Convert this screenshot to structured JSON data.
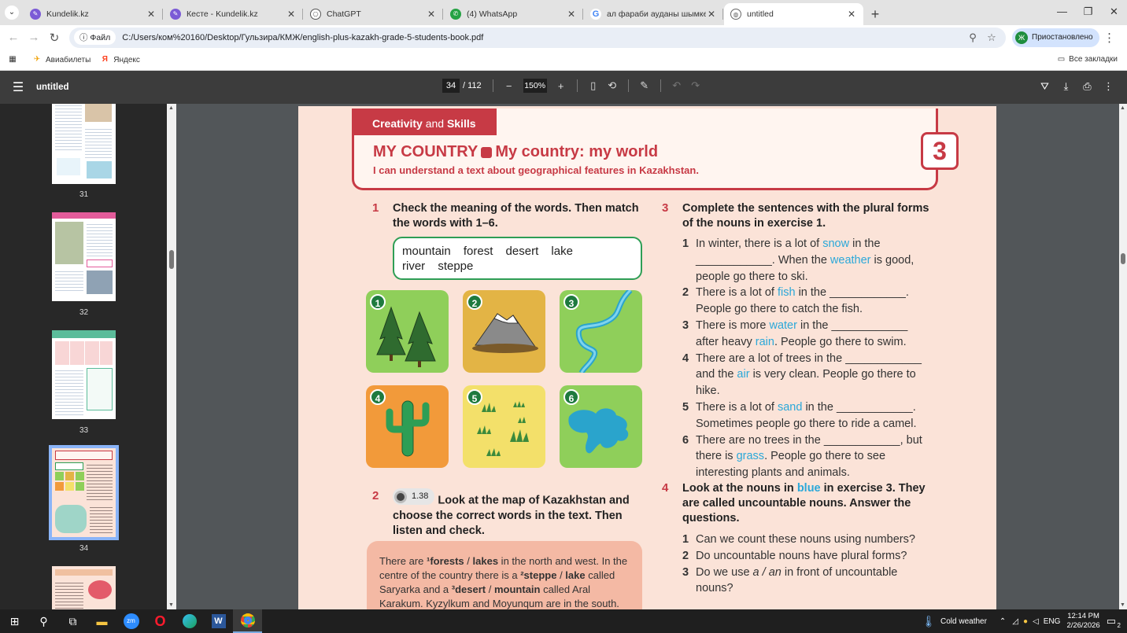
{
  "browser": {
    "tabs": [
      {
        "title": "Kundelik.kz",
        "icon": "kundelik-icon",
        "active": false
      },
      {
        "title": "Кесте - Kundelik.kz",
        "icon": "kundelik-icon",
        "active": false
      },
      {
        "title": "ChatGPT",
        "icon": "chatgpt-icon",
        "active": false
      },
      {
        "title": "(4) WhatsApp",
        "icon": "whatsapp-icon",
        "active": false
      },
      {
        "title": "ал фараби ауданы шымкент -",
        "icon": "google-icon",
        "active": false
      },
      {
        "title": "untitled",
        "icon": "globe-icon",
        "active": true
      }
    ],
    "file_chip": "Файл",
    "url": "C:/Users/ком%20160/Desktop/Гульзира/КМЖ/english-plus-kazakh-grade-5-students-book.pdf",
    "profile_initial": "Ж",
    "profile_label": "Приостановлено",
    "bookmarks": [
      {
        "label": "Авиабилеты",
        "icon": "plane-icon"
      },
      {
        "label": "Яндекс",
        "icon": "yandex-icon"
      }
    ],
    "all_bookmarks": "Все закладки"
  },
  "pdf": {
    "title": "untitled",
    "page_current": "34",
    "page_total": "/ 112",
    "zoom": "150%",
    "thumbnails": [
      {
        "num": "31"
      },
      {
        "num": "32"
      },
      {
        "num": "33"
      },
      {
        "num": "34"
      }
    ]
  },
  "page": {
    "section_tab_1": "Creativity",
    "section_tab_and": "and",
    "section_tab_2": "Skills",
    "unit_title": "MY COUNTRY",
    "unit_subtitle": "My country: my world",
    "can_do": "I can understand a text about geographical features in Kazakhstan.",
    "unit_number": "3",
    "ex1": {
      "num": "1",
      "heading": "Check the meaning of the words. Then match the words with 1–6.",
      "words_line1": "mountain forest desert lake",
      "words_line2": "river steppe",
      "images": [
        "1",
        "2",
        "3",
        "4",
        "5",
        "6"
      ]
    },
    "ex2": {
      "num": "2",
      "audio": "1.38",
      "heading": "Look at the map of Kazakhstan and choose the correct words in the text. Then listen and check.",
      "text": {
        "a": "There are ",
        "b": "¹forests",
        "c": " / ",
        "d": "lakes",
        "e": " in the north and west. In the centre of the country there is a ",
        "f": "²steppe",
        "g": " / ",
        "h": "lake",
        "i": " called Saryarka and a ",
        "j": "³desert",
        "k": " / ",
        "l": "mountain",
        "m": " called Aral Karakum. Kyzylkum and Moyunqum are in the south."
      }
    },
    "ex3": {
      "num": "3",
      "heading": "Complete the sentences with the plural forms of the nouns in exercise 1.",
      "items": [
        {
          "k": "1",
          "a": "In winter, there is a lot of ",
          "b": "snow",
          "c": " in the ____________. When the ",
          "d": "weather",
          "e": " is good, people go there to ski."
        },
        {
          "k": "2",
          "a": "There is a lot of ",
          "b": "fish",
          "c": " in the ____________. People go there to catch the fish.",
          "d": "",
          "e": ""
        },
        {
          "k": "3",
          "a": "There is more ",
          "b": "water",
          "c": " in the ____________ after heavy ",
          "d": "rain",
          "e": ". People go there to swim."
        },
        {
          "k": "4",
          "a": "There are a lot of trees in the ____________ and the ",
          "b": "air",
          "c": " is very clean. People go there to hike.",
          "d": "",
          "e": ""
        },
        {
          "k": "5",
          "a": "There is a lot of ",
          "b": "sand",
          "c": " in the ____________. Sometimes people go there to ride a camel.",
          "d": "",
          "e": ""
        },
        {
          "k": "6",
          "a": "There are no trees in the ____________, but there is ",
          "b": "grass",
          "c": ". People go there to see interesting plants and animals.",
          "d": "",
          "e": ""
        }
      ]
    },
    "ex4": {
      "num": "4",
      "heading_a": "Look at the nouns in ",
      "heading_b": "blue",
      "heading_c": " in exercise 3. They are called uncountable nouns. Answer the questions.",
      "items": [
        {
          "k": "1",
          "text": "Can we count these nouns using numbers?"
        },
        {
          "k": "2",
          "text": "Do uncountable nouns have plural forms?"
        },
        {
          "k": "3a",
          "text": "Do we use "
        },
        {
          "k": "3b",
          "text": "a / an"
        },
        {
          "k": "3c",
          "text": " in front of uncountable nouns?"
        }
      ]
    }
  },
  "taskbar": {
    "weather": "Cold weather",
    "lang": "ENG",
    "time": "12:14 PM",
    "date": "2/26/2026",
    "notifications": "2"
  },
  "colors": {
    "accent": "#c73a45",
    "green": "#2e9e55",
    "blue_word": "#2ba8d9"
  }
}
